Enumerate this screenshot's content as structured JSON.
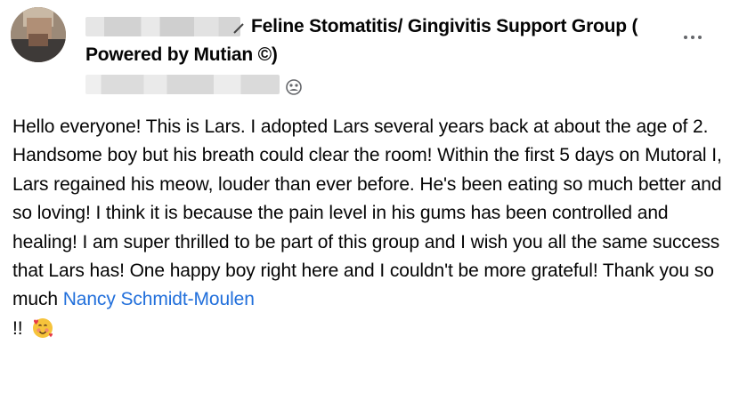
{
  "post": {
    "group_name": "Feline Stomatitis/ Gingivitis Support Group ( Powered by Mutian ©)",
    "menu_icon": "more-horizontal-icon",
    "privacy_icon": "group-globe-icon",
    "author_avatar": "blurred-profile-photo",
    "body": {
      "text": "Hello everyone! This is Lars. I adopted Lars several years back at about the age of 2. Handsome boy but his breath could clear the room! Within the first 5 days on Mutoral I, Lars regained his meow, louder than ever before.  He's been eating so much better and so loving! I think it is because the pain level in his gums has been controlled and healing! I am super thrilled to be part of this group and I wish you all the same success that Lars has! One happy boy right here and I couldn't be more grateful! Thank you so much",
      "mention": "Nancy Schmidt-Moulen",
      "suffix": "!!",
      "emoji": "smiling-face-with-hearts-emoji"
    }
  },
  "colors": {
    "text": "#050505",
    "mention": "#216fdb",
    "secondary": "#65676b"
  }
}
